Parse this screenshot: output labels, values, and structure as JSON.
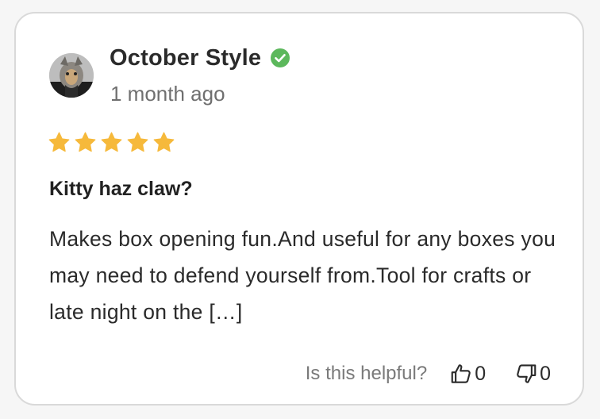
{
  "review": {
    "author": "October Style",
    "verified": true,
    "time_ago": "1 month ago",
    "rating": 5,
    "rating_max": 5,
    "title": "Kitty haz claw?",
    "body": "Makes box opening fun.And useful for any boxes you may need to defend yourself from.Tool for crafts or late night on the […]",
    "helpful_label": "Is this helpful?",
    "helpful_yes_count": "0",
    "helpful_no_count": "0"
  },
  "colors": {
    "star": "#f6b93b",
    "verified": "#5cb85c",
    "card_border": "#d9d9d9"
  },
  "icons": {
    "verified": "check-badge-icon",
    "star": "star-icon",
    "thumbs_up": "thumbs-up-icon",
    "thumbs_down": "thumbs-down-icon"
  }
}
